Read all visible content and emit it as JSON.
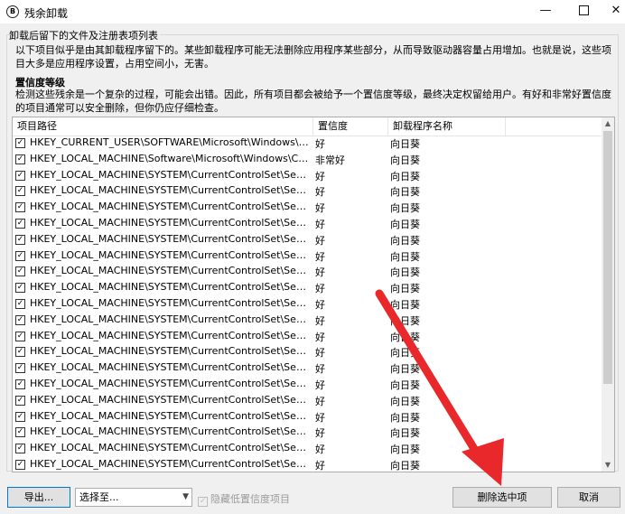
{
  "window": {
    "title": "残余卸载",
    "icon_letter": "B",
    "minimize_glyph": "—",
    "close_glyph": "✕"
  },
  "group": {
    "legend": "卸载后留下的文件及注册表项列表",
    "description": "以下项目似乎是由其卸载程序留下的。某些卸载程序可能无法删除应用程序某些部分，从而导致驱动器容量占用增加。也就是说，这些项目大多是应用程序设置，占用空间小，无害。",
    "confidence_heading": "置信度等级",
    "confidence_description": "检测这些残余是一个复杂的过程，可能会出错。因此，所有项目都会被给予一个置信度等级，最终决定权留给用户。有好和非常好置信度的项目通常可以安全删除，但你仍应仔细检查。"
  },
  "list": {
    "columns": [
      "项目路径",
      "置信度",
      "卸载程序名称"
    ],
    "sorted_column": "卸载程序名称",
    "rows": [
      {
        "checked": true,
        "path": "HKEY_CURRENT_USER\\SOFTWARE\\Microsoft\\Windows\\CurrentV...",
        "confidence": "好",
        "program": "向日葵"
      },
      {
        "checked": true,
        "path": "HKEY_LOCAL_MACHINE\\Software\\Microsoft\\Windows\\CurrentVe...",
        "confidence": "非常好",
        "program": "向日葵"
      },
      {
        "checked": true,
        "path": "HKEY_LOCAL_MACHINE\\SYSTEM\\CurrentControlSet\\Services\\Sh...",
        "confidence": "好",
        "program": "向日葵"
      },
      {
        "checked": true,
        "path": "HKEY_LOCAL_MACHINE\\SYSTEM\\CurrentControlSet\\Services\\Sh...",
        "confidence": "好",
        "program": "向日葵"
      },
      {
        "checked": true,
        "path": "HKEY_LOCAL_MACHINE\\SYSTEM\\CurrentControlSet\\Services\\Sh...",
        "confidence": "好",
        "program": "向日葵"
      },
      {
        "checked": true,
        "path": "HKEY_LOCAL_MACHINE\\SYSTEM\\CurrentControlSet\\Services\\Sh...",
        "confidence": "好",
        "program": "向日葵"
      },
      {
        "checked": true,
        "path": "HKEY_LOCAL_MACHINE\\SYSTEM\\CurrentControlSet\\Services\\Sh...",
        "confidence": "好",
        "program": "向日葵"
      },
      {
        "checked": true,
        "path": "HKEY_LOCAL_MACHINE\\SYSTEM\\CurrentControlSet\\Services\\Sh...",
        "confidence": "好",
        "program": "向日葵"
      },
      {
        "checked": true,
        "path": "HKEY_LOCAL_MACHINE\\SYSTEM\\CurrentControlSet\\Services\\Sh...",
        "confidence": "好",
        "program": "向日葵"
      },
      {
        "checked": true,
        "path": "HKEY_LOCAL_MACHINE\\SYSTEM\\CurrentControlSet\\Services\\Sh...",
        "confidence": "好",
        "program": "向日葵"
      },
      {
        "checked": true,
        "path": "HKEY_LOCAL_MACHINE\\SYSTEM\\CurrentControlSet\\Services\\Sh...",
        "confidence": "好",
        "program": "向日葵"
      },
      {
        "checked": true,
        "path": "HKEY_LOCAL_MACHINE\\SYSTEM\\CurrentControlSet\\Services\\Sh...",
        "confidence": "好",
        "program": "向日葵"
      },
      {
        "checked": true,
        "path": "HKEY_LOCAL_MACHINE\\SYSTEM\\CurrentControlSet\\Services\\Sh...",
        "confidence": "好",
        "program": "向日葵"
      },
      {
        "checked": true,
        "path": "HKEY_LOCAL_MACHINE\\SYSTEM\\CurrentControlSet\\Services\\Sh...",
        "confidence": "好",
        "program": "向日葵"
      },
      {
        "checked": true,
        "path": "HKEY_LOCAL_MACHINE\\SYSTEM\\CurrentControlSet\\Services\\Sh...",
        "confidence": "好",
        "program": "向日葵"
      },
      {
        "checked": true,
        "path": "HKEY_LOCAL_MACHINE\\SYSTEM\\CurrentControlSet\\Services\\Sh...",
        "confidence": "好",
        "program": "向日葵"
      },
      {
        "checked": true,
        "path": "HKEY_LOCAL_MACHINE\\SYSTEM\\CurrentControlSet\\Services\\Sh...",
        "confidence": "好",
        "program": "向日葵"
      },
      {
        "checked": true,
        "path": "HKEY_LOCAL_MACHINE\\SYSTEM\\CurrentControlSet\\Services\\Sh...",
        "confidence": "好",
        "program": "向日葵"
      },
      {
        "checked": true,
        "path": "HKEY_LOCAL_MACHINE\\SYSTEM\\CurrentControlSet\\Services\\Sh...",
        "confidence": "好",
        "program": "向日葵"
      },
      {
        "checked": true,
        "path": "HKEY_LOCAL_MACHINE\\SYSTEM\\CurrentControlSet\\Services\\Sh...",
        "confidence": "好",
        "program": "向日葵"
      },
      {
        "checked": true,
        "path": "HKEY_LOCAL_MACHINE\\SYSTEM\\CurrentControlSet\\Services\\Sh...",
        "confidence": "好",
        "program": "向日葵"
      },
      {
        "checked": true,
        "path": "HKEY_LOCAL_MACHINE\\SYSTEM\\CurrentControlSet\\Services\\Sh...",
        "confidence": "好",
        "program": "向日葵"
      }
    ]
  },
  "footer": {
    "export_label": "导出...",
    "select_to_label": "选择至...",
    "hide_low_label": "隐藏低置信度项目",
    "remove_label": "删除选中项",
    "cancel_label": "取消"
  },
  "annotation": {
    "arrow_color": "#e8282b"
  }
}
